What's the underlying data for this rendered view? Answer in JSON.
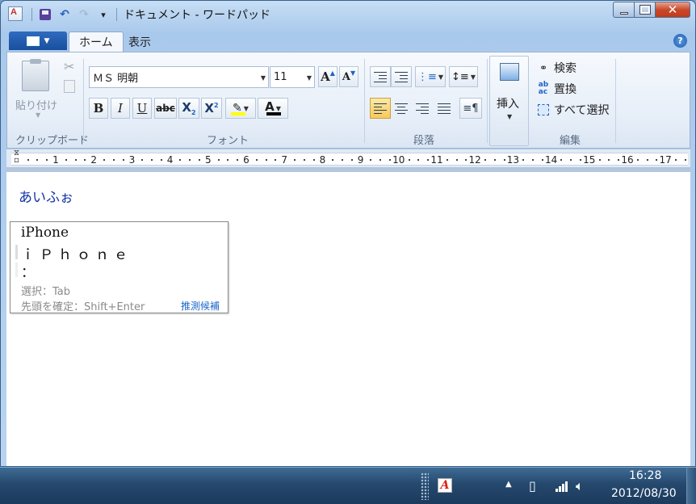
{
  "window": {
    "title": "ドキュメント - ワードパッド",
    "caption": {
      "minimize": "—",
      "maximize": "□",
      "close": "✕"
    }
  },
  "quick_access": {
    "customize": "▾"
  },
  "ribbon": {
    "tabs": [
      {
        "label": "ホーム",
        "active": true
      },
      {
        "label": "表示",
        "active": false
      }
    ],
    "help": "?",
    "clipboard": {
      "paste_label": "貼り付け",
      "group_label": "クリップボード"
    },
    "font": {
      "family": "ＭＳ 明朝",
      "size": "11",
      "grow": "A",
      "shrink": "A",
      "bold": "B",
      "italic": "I",
      "underline": "U",
      "strikethrough": "abc",
      "subscript": "X",
      "subscript_mark": "2",
      "superscript": "X",
      "superscript_mark": "2",
      "font_color_letter": "A",
      "group_label": "フォント"
    },
    "paragraph": {
      "group_label": "段落",
      "active_alignment": "left"
    },
    "insert": {
      "label": "挿入"
    },
    "editing": {
      "find": "検索",
      "replace": "置換",
      "select_all": "すべて選択",
      "group_label": "編集"
    }
  },
  "ruler": {
    "numbers": [
      "1",
      "2",
      "3",
      "4",
      "5",
      "6",
      "7",
      "8",
      "9",
      "10",
      "11",
      "12",
      "13",
      "14",
      "15",
      "16",
      "17"
    ]
  },
  "document": {
    "text": "あいふぉ"
  },
  "ime": {
    "candidates": [
      "iPhone",
      "ｉＰｈｏｎｅ",
      "："
    ],
    "hint_select": "選択：Tab",
    "hint_confirm": "先頭を確定：Shift+Enter",
    "suggest_label": "推測候補"
  },
  "taskbar": {
    "time": "16:28",
    "date": "2012/08/30",
    "tray_app_letter": "A"
  },
  "colors": {
    "document_text": "#1434a8",
    "link_blue": "#1a66c9",
    "close_red": "#c9492a",
    "selected_alignment": "#f7c95c",
    "highlight_yellow": "#ffff00"
  }
}
